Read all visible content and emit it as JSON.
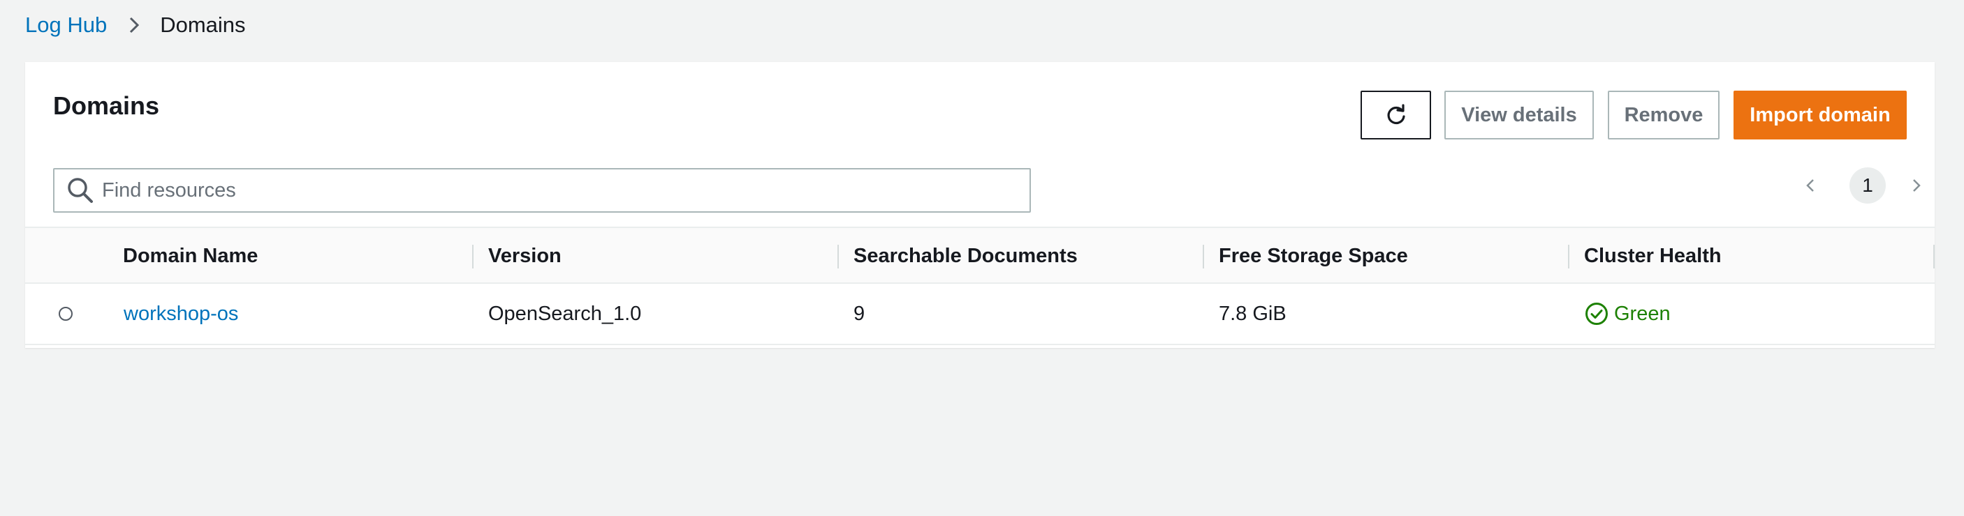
{
  "breadcrumb": {
    "root": "Log Hub",
    "current": "Domains",
    "separator_icon": "chevron-right-icon"
  },
  "panel": {
    "title": "Domains"
  },
  "actions": {
    "refresh_icon": "refresh-icon",
    "view_details": "View details",
    "remove": "Remove",
    "import_domain": "Import domain"
  },
  "search": {
    "placeholder": "Find resources",
    "value": "",
    "icon": "search-icon"
  },
  "pagination": {
    "current_page": "1",
    "prev_icon": "chevron-left-icon",
    "next_icon": "chevron-right-icon"
  },
  "table": {
    "columns": [
      "Domain Name",
      "Version",
      "Searchable Documents",
      "Free Storage Space",
      "Cluster Health"
    ],
    "rows": [
      {
        "selected": false,
        "domain_name": "workshop-os",
        "version": "OpenSearch_1.0",
        "searchable_documents": "9",
        "free_storage_space": "7.8 GiB",
        "cluster_health": "Green",
        "health_icon": "check-circle-icon"
      }
    ]
  },
  "colors": {
    "link": "#0073bb",
    "primary": "#ec7211",
    "success": "#1d8102",
    "background": "#f2f3f3"
  }
}
